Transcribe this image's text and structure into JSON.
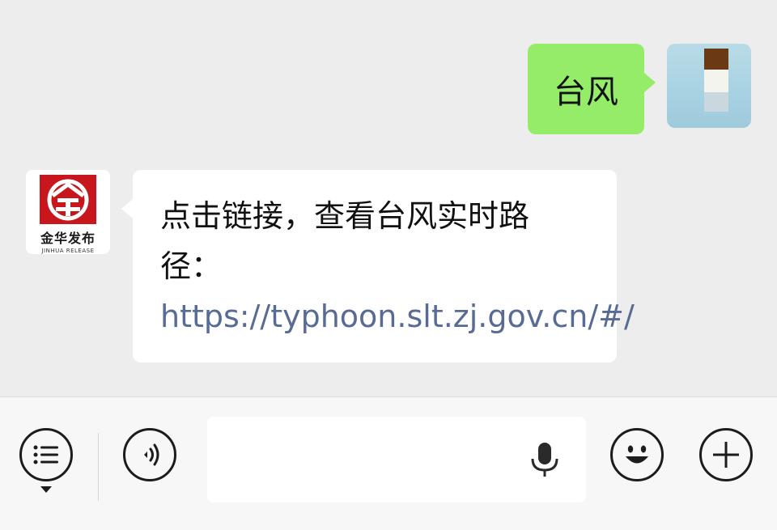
{
  "conversation": {
    "outgoing": {
      "text": "台风"
    },
    "incoming": {
      "sender_logo_name": "金华发布",
      "sender_logo_sub": "JINHUA RELEASE",
      "text": "点击链接，查看台风实时路径：",
      "link": "https://typhoon.slt.zj.gov.cn/#/"
    }
  },
  "input_bar": {
    "message_placeholder": "",
    "icons": [
      "menu-icon",
      "voice-icon",
      "microphone-icon",
      "emoji-icon",
      "plus-icon"
    ]
  },
  "colors": {
    "chat_background": "#ededed",
    "outgoing_bubble": "#95ec69",
    "incoming_bubble": "#ffffff",
    "link": "#576b95",
    "logo_red": "#c8161d",
    "input_bar": "#f7f7f7"
  }
}
